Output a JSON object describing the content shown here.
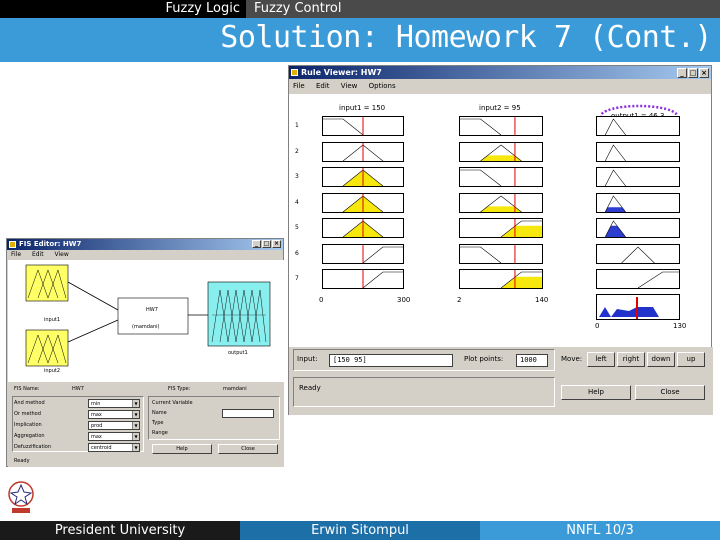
{
  "slide": {
    "breadcrumb": [
      "Fuzzy Logic",
      "Fuzzy Control"
    ],
    "title": "Solution: Homework 7 (Cont.)",
    "footer": {
      "left": "President University",
      "center": "Erwin Sitompul",
      "right": "NNFL 10/3"
    }
  },
  "rule_viewer": {
    "window_title": "Rule Viewer: HW7",
    "menu": [
      "File",
      "Edit",
      "View",
      "Options"
    ],
    "inputs": [
      {
        "label": "input1 = 150",
        "range_min": "0",
        "range_max": "300"
      },
      {
        "label": "input2 = 95",
        "range_min": "2",
        "range_max": "140"
      }
    ],
    "output": {
      "label": "output1 = 46.3",
      "range_min": "0",
      "range_max": "130"
    },
    "rules": [
      "1",
      "2",
      "3",
      "4",
      "5",
      "6",
      "7"
    ],
    "input_label": "Input:",
    "input_value": "[150 95]",
    "plot_points_label": "Plot points:",
    "plot_points_value": "1000",
    "move_label": "Move:",
    "move_buttons": [
      "left",
      "right",
      "down",
      "up"
    ],
    "status": "Ready",
    "help_button": "Help",
    "close_button": "Close"
  },
  "fis_editor": {
    "window_title": "FIS Editor: HW7",
    "menu": [
      "File",
      "Edit",
      "View"
    ],
    "input_names": [
      "input1",
      "input2"
    ],
    "output_name": "output1",
    "system_name": "HW7",
    "system_type_caption": "(mamdani)",
    "fis_name_label": "FIS Name:",
    "fis_name_value": "HW7",
    "fis_type_label": "FIS Type:",
    "fis_type_value": "mamdani",
    "methods": [
      {
        "label": "And method",
        "value": "min"
      },
      {
        "label": "Or method",
        "value": "max"
      },
      {
        "label": "Implication",
        "value": "prod"
      },
      {
        "label": "Aggregation",
        "value": "max"
      },
      {
        "label": "Defuzzification",
        "value": "centroid"
      }
    ],
    "current_variable_label": "Current Variable",
    "fields": [
      "Name",
      "Type",
      "Range"
    ],
    "help_button": "Help",
    "close_button": "Close",
    "status": "Ready"
  }
}
